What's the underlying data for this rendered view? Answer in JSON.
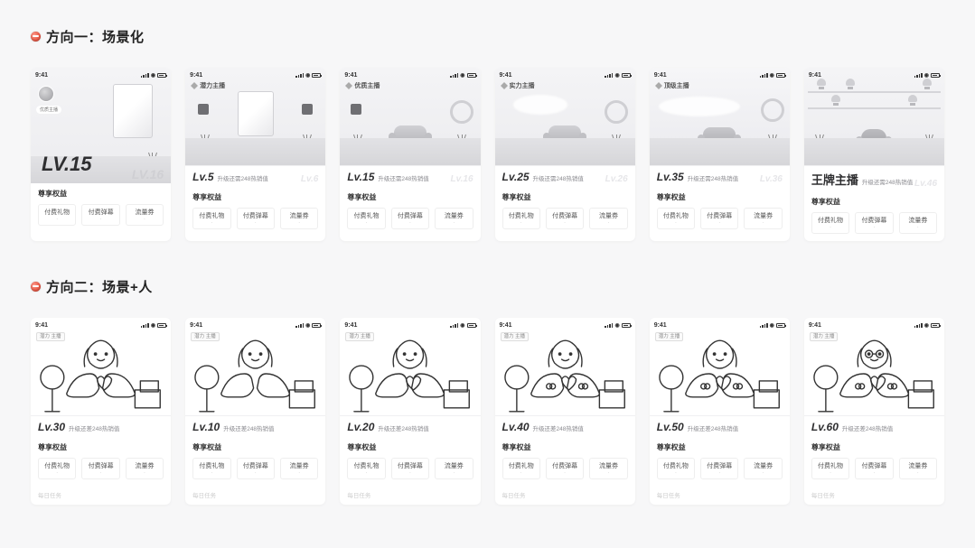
{
  "status_time": "9:41",
  "section1": {
    "title": "方向一：场景化",
    "cards": [
      {
        "badge": "",
        "lv": "LV.15",
        "ghost": "LV.16",
        "sub": "",
        "benefit": "尊享权益",
        "tags": [
          "付费礼物",
          "付费弹幕",
          "流量券"
        ],
        "extra": "",
        "scene": "studio-big"
      },
      {
        "badge": "潜力主播",
        "lv": "Lv.5",
        "ghost": "Lv.6",
        "sub": "升级还需248热销值",
        "benefit": "尊享权益",
        "tags": [
          "付费礼物",
          "付费弹幕",
          "流量券"
        ],
        "extra": "",
        "scene": "studio"
      },
      {
        "badge": "优质主播",
        "lv": "Lv.15",
        "ghost": "Lv.16",
        "sub": "升级还需248热销值",
        "benefit": "尊享权益",
        "tags": [
          "付费礼物",
          "付费弹幕",
          "流量券"
        ],
        "extra": "",
        "scene": "lounge"
      },
      {
        "badge": "实力主播",
        "lv": "Lv.25",
        "ghost": "Lv.26",
        "sub": "升级还需248热销值",
        "benefit": "尊享权益",
        "tags": [
          "付费礼物",
          "付费弹幕",
          "流量券"
        ],
        "extra": "",
        "scene": "lounge"
      },
      {
        "badge": "顶级主播",
        "lv": "Lv.35",
        "ghost": "Lv.36",
        "sub": "升级还需248热销值",
        "benefit": "尊享权益",
        "tags": [
          "付费礼物",
          "付费弹幕",
          "流量券"
        ],
        "extra": "",
        "scene": "premium"
      },
      {
        "badge": "",
        "lv": "王牌主播",
        "ghost": "Lv.46",
        "sub": "升级还需248热销值",
        "benefit": "尊享权益",
        "tags": [
          "付费礼物",
          "付费弹幕",
          "流量券"
        ],
        "extra": "",
        "scene": "trophy"
      }
    ]
  },
  "section2": {
    "title": "方向二：场景+人",
    "cards": [
      {
        "lv": "Lv.30",
        "sub": "升级还差248热销值",
        "benefit": "尊享权益",
        "tags": [
          "付费礼物",
          "付费弹幕",
          "流量券"
        ],
        "extra": "每日任务",
        "pin": "潜力\n主播"
      },
      {
        "lv": "Lv.10",
        "sub": "升级还差248热销值",
        "benefit": "尊享权益",
        "tags": [
          "付费礼物",
          "付费弹幕",
          "流量券"
        ],
        "extra": "每日任务",
        "pin": "潜力\n主播"
      },
      {
        "lv": "Lv.20",
        "sub": "升级还差248热销值",
        "benefit": "尊享权益",
        "tags": [
          "付费礼物",
          "付费弹幕",
          "流量券"
        ],
        "extra": "每日任务",
        "pin": "潜力\n主播"
      },
      {
        "lv": "Lv.40",
        "sub": "升级还差248热销值",
        "benefit": "尊享权益",
        "tags": [
          "付费礼物",
          "付费弹幕",
          "流量券"
        ],
        "extra": "每日任务",
        "pin": "潜力\n主播"
      },
      {
        "lv": "Lv.50",
        "sub": "升级还差248热销值",
        "benefit": "尊享权益",
        "tags": [
          "付费礼物",
          "付费弹幕",
          "流量券"
        ],
        "extra": "每日任务",
        "pin": "潜力\n主播"
      },
      {
        "lv": "Lv.60",
        "sub": "升级还差248热销值",
        "benefit": "尊享权益",
        "tags": [
          "付费礼物",
          "付费弹幕",
          "流量券"
        ],
        "extra": "每日任务",
        "pin": "潜力\n主播"
      }
    ]
  },
  "card0_avatar_label": "优质主播"
}
